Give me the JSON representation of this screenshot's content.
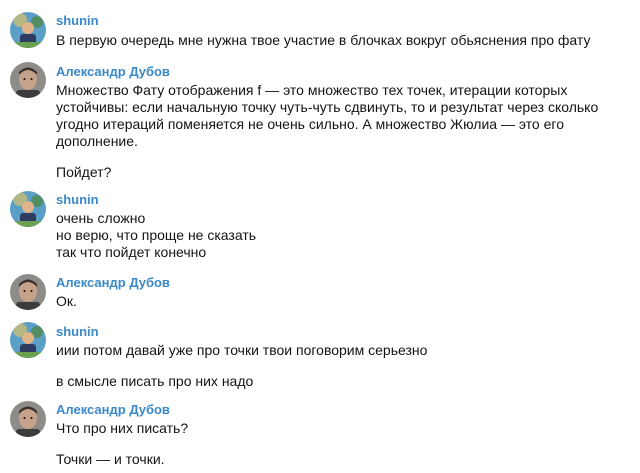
{
  "colors": {
    "author": "#3a89c9",
    "text": "#141414",
    "background": "#ffffff"
  },
  "messages": [
    {
      "author": "shunin",
      "avatar": "shunin-avatar",
      "lines": [
        "В первую очередь мне нужна твое участие в блочках вокруг обьяснения про фату"
      ]
    },
    {
      "author": "Александр Дубов",
      "avatar": "dubov-avatar",
      "lines": [
        "Множество Фату отображения f — это множество тех точек, итерации которых",
        "устойчивы: если начальную точку чуть-чуть сдвинуть, то и результат через сколько",
        "угодно итераций поменяется не очень сильно. А множество Жюлиа — это его",
        "дополнение.",
        "Пойдет?"
      ]
    },
    {
      "author": "shunin",
      "avatar": "shunin-avatar",
      "lines": [
        "очень сложно",
        "но верю, что проще не сказать",
        "так что пойдет конечно"
      ]
    },
    {
      "author": "Александр Дубов",
      "avatar": "dubov-avatar",
      "lines": [
        "Ок."
      ]
    },
    {
      "author": "shunin",
      "avatar": "shunin-avatar",
      "lines": [
        "иии потом давай уже про точки твои поговорим серьезно",
        "в смысле писать про них надо"
      ]
    },
    {
      "author": "Александр Дубов",
      "avatar": "dubov-avatar",
      "lines": [
        "Что про них писать?",
        "Точки — и точки."
      ]
    }
  ]
}
